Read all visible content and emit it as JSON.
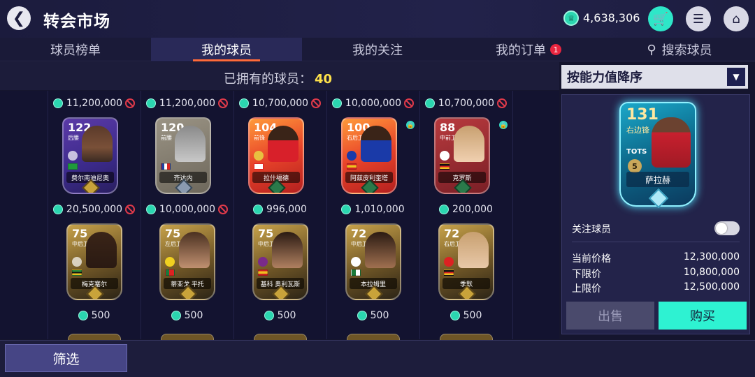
{
  "header": {
    "title": "转会市场",
    "coin_balance": "4,638,306",
    "back_icon": "back-arrow-icon",
    "cart_icon": "cart-icon",
    "menu_icon": "menu-icon",
    "home_icon": "home-icon"
  },
  "tabs": [
    {
      "label": "球员榜单",
      "active": false
    },
    {
      "label": "我的球员",
      "active": true
    },
    {
      "label": "我的关注",
      "active": false
    },
    {
      "label": "我的订单",
      "active": false,
      "badge": "1"
    },
    {
      "label": "搜索球员",
      "active": false
    }
  ],
  "owned": {
    "label": "已拥有的球员：",
    "count": "40"
  },
  "sort": {
    "selected": "按能力值降序"
  },
  "top_prices": [
    "11,200,000",
    "11,200,000",
    "10,700,000",
    "10,000,000",
    "10,700,000"
  ],
  "row1": [
    {
      "rating": "122",
      "pos": "后腰",
      "name": "费尔南迪尼奥",
      "price": "20,500,000",
      "style": "purple",
      "locked": false,
      "blocked": true
    },
    {
      "rating": "120",
      "pos": "前腰",
      "name": "齐达内",
      "price": "10,000,000",
      "style": "grey",
      "locked": false,
      "blocked": true
    },
    {
      "rating": "104",
      "pos": "前锋",
      "name": "拉什福德",
      "price": "996,000",
      "style": "fire",
      "locked": true,
      "blocked": false
    },
    {
      "rating": "100",
      "pos": "右后卫",
      "name": "阿兹皮利奎塔",
      "price": "1,010,000",
      "style": "fire",
      "locked": true,
      "blocked": false
    },
    {
      "rating": "88",
      "pos": "中前卫",
      "name": "克罗斯",
      "price": "200,000",
      "style": "red",
      "locked": true,
      "blocked": false
    }
  ],
  "row2": [
    {
      "rating": "75",
      "pos": "中后卫",
      "name": "梅克塞尔",
      "price": "500",
      "style": "gold"
    },
    {
      "rating": "75",
      "pos": "左后卫",
      "name": "蒂亚戈 平托",
      "price": "500",
      "style": "gold"
    },
    {
      "rating": "75",
      "pos": "中后卫",
      "name": "基科 奥利瓦斯",
      "price": "500",
      "style": "gold"
    },
    {
      "rating": "72",
      "pos": "中后卫",
      "name": "本拉姆里",
      "price": "500",
      "style": "gold"
    },
    {
      "rating": "72",
      "pos": "右后卫",
      "name": "季默",
      "price": "500",
      "style": "gold"
    }
  ],
  "featured": {
    "rating": "131",
    "pos": "右边锋",
    "program": "TOTS",
    "level": "5",
    "name": "萨拉赫",
    "follow_label": "关注球员",
    "follow_on": false,
    "current_price_label": "当前价格",
    "current_price": "12,300,000",
    "min_price_label": "下限价",
    "min_price": "10,800,000",
    "max_price_label": "上限价",
    "max_price": "12,500,000",
    "sell_label": "出售",
    "buy_label": "购买"
  },
  "filter_label": "筛选",
  "colors": {
    "accent": "#2ef2d2",
    "tab_underline": "#ff6a3a",
    "badge": "#e8253f",
    "count": "#ffe24a"
  }
}
